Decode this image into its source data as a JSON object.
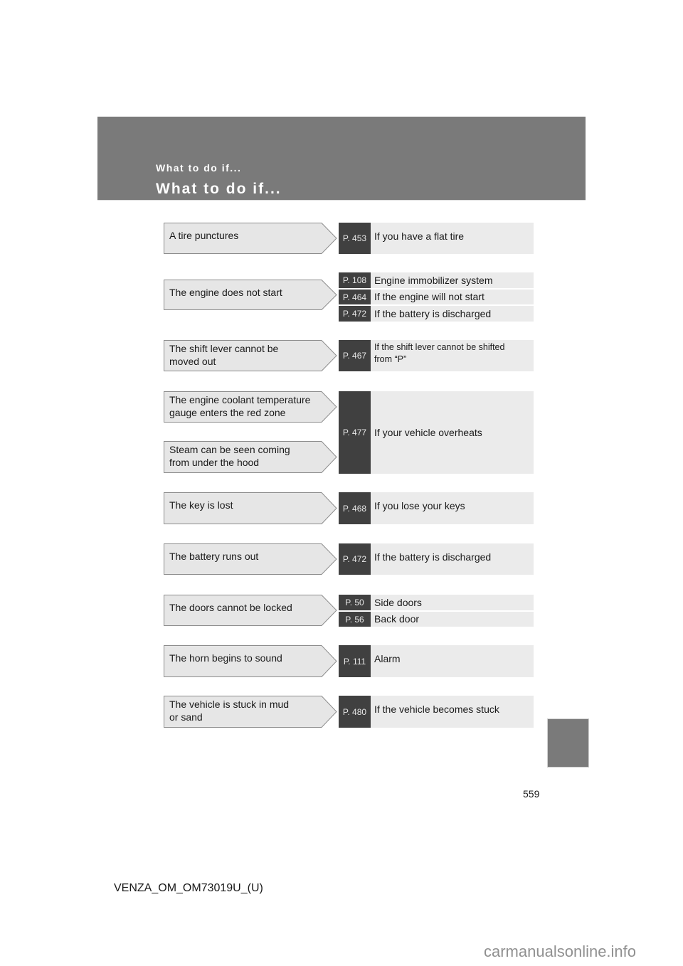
{
  "header": {
    "subtitle": "What to do if...",
    "title": "What to do if..."
  },
  "entries": [
    {
      "situations": [
        "A tire punctures"
      ],
      "refs": [
        {
          "page": "P. 453",
          "desc": "If you have a flat tire"
        }
      ]
    },
    {
      "situations": [
        "The engine does not start"
      ],
      "refs": [
        {
          "page": "P. 108",
          "desc": "Engine immobilizer system"
        },
        {
          "page": "P. 464",
          "desc": "If the engine will not start"
        },
        {
          "page": "P. 472",
          "desc": "If the battery is discharged"
        }
      ]
    },
    {
      "situations": [
        "The shift lever cannot be\nmoved out"
      ],
      "refs": [
        {
          "page": "P. 467",
          "desc": "If the shift lever cannot be shifted\nfrom “P”"
        }
      ]
    },
    {
      "situations": [
        "The engine coolant temperature\ngauge enters the red zone",
        "Steam can be seen coming\nfrom under the hood"
      ],
      "refs": [
        {
          "page": "P. 477",
          "desc": "If your vehicle overheats"
        }
      ]
    },
    {
      "situations": [
        "The key is lost"
      ],
      "refs": [
        {
          "page": "P. 468",
          "desc": "If you lose your keys"
        }
      ]
    },
    {
      "situations": [
        "The battery runs out"
      ],
      "refs": [
        {
          "page": "P. 472",
          "desc": "If the battery is discharged"
        }
      ]
    },
    {
      "situations": [
        "The doors cannot be locked"
      ],
      "refs": [
        {
          "page": "P. 50",
          "desc": "Side doors"
        },
        {
          "page": "P. 56",
          "desc": "Back door"
        }
      ]
    },
    {
      "situations": [
        "The horn begins to sound"
      ],
      "refs": [
        {
          "page": "P. 111",
          "desc": "Alarm"
        }
      ]
    },
    {
      "situations": [
        "The vehicle is stuck in mud\nor sand"
      ],
      "refs": [
        {
          "page": "P. 480",
          "desc": "If the vehicle becomes stuck"
        }
      ]
    }
  ],
  "footer": {
    "page_number": "559",
    "doc_code": "VENZA_OM_OM73019U_(U)",
    "watermark": "carmanualsonline.info"
  }
}
